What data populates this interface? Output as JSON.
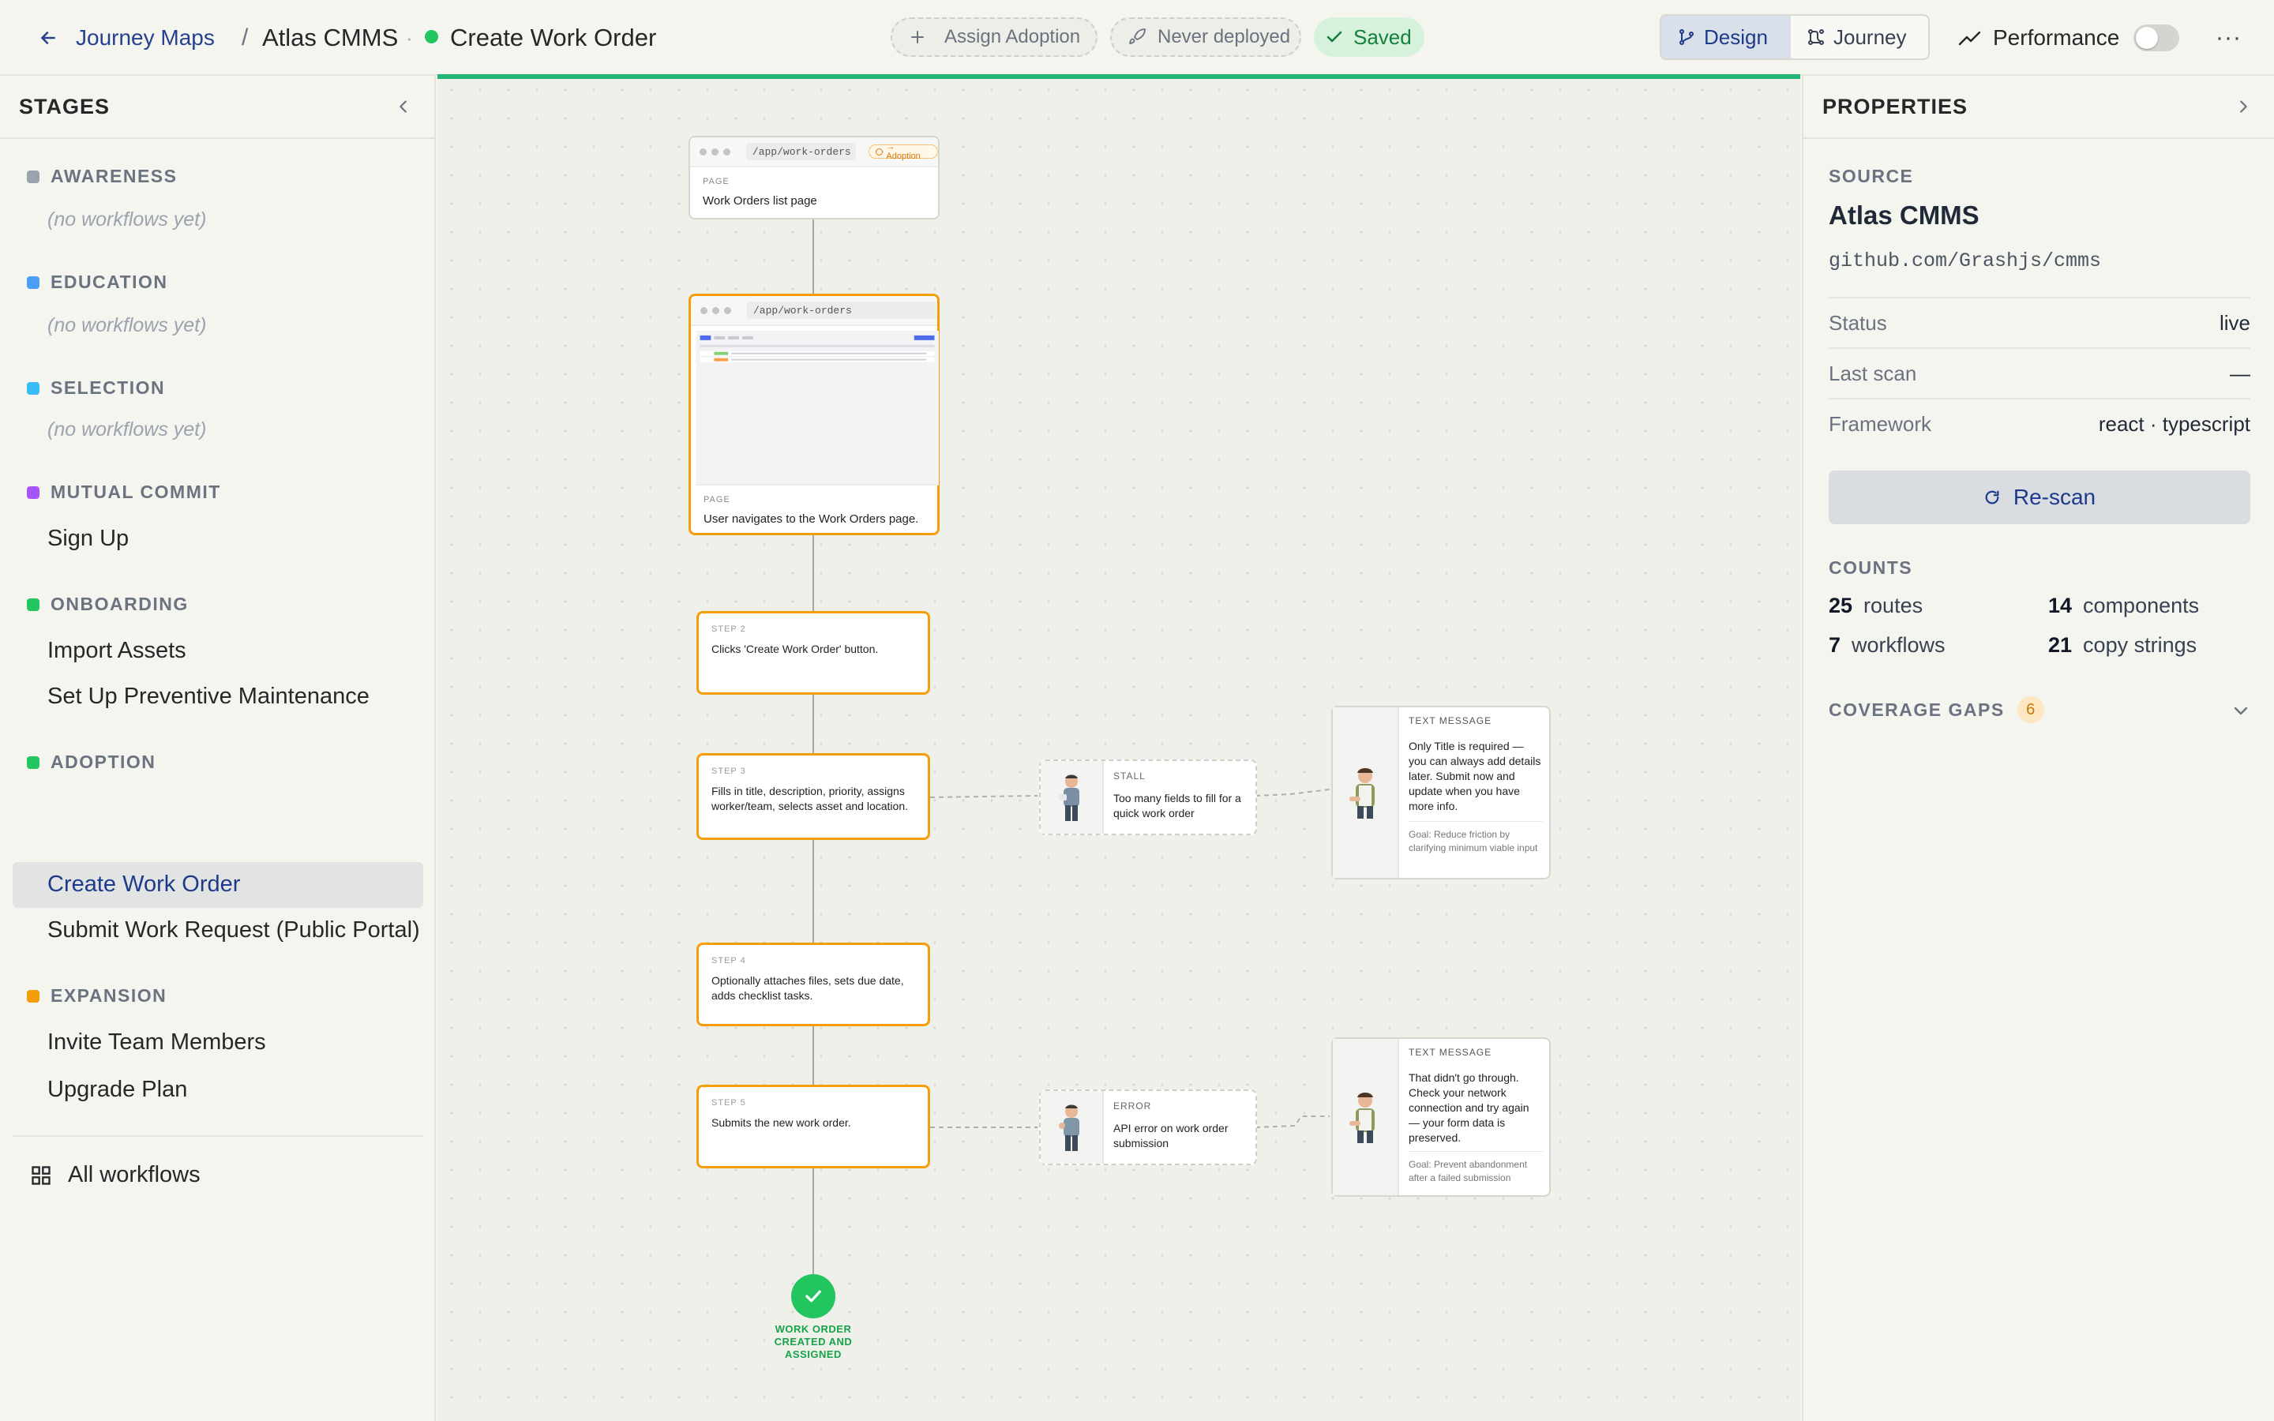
{
  "header": {
    "back_label": "Journey Maps",
    "breadcrumb_sep": "/",
    "app_name": "Atlas CMMS",
    "dot_sep": "·",
    "page_title": "Create Work Order",
    "status_color": "#22c55e",
    "assign_label": "Assign Adoption",
    "deploy_label": "Never deployed",
    "saved_label": "Saved",
    "view_tabs": [
      {
        "label": "Design",
        "icon": "branch-icon",
        "active": true
      },
      {
        "label": "Journey",
        "icon": "journey-icon",
        "active": false
      }
    ],
    "performance_label": "Performance",
    "performance_enabled": false,
    "more_label": "···"
  },
  "sidebar": {
    "title": "STAGES",
    "stages": [
      {
        "name": "AWARENESS",
        "color": "#9aa3ad",
        "empty": "(no workflows yet)",
        "workflows": []
      },
      {
        "name": "EDUCATION",
        "color": "#4a9ff5",
        "empty": "(no workflows yet)",
        "workflows": []
      },
      {
        "name": "SELECTION",
        "color": "#38bdf8",
        "empty": "(no workflows yet)",
        "workflows": []
      },
      {
        "name": "MUTUAL COMMIT",
        "color": "#a855f7",
        "workflows": [
          "Sign Up"
        ]
      },
      {
        "name": "ONBOARDING",
        "color": "#22c55e",
        "workflows": [
          "Import Assets",
          "Set Up Preventive Maintenance"
        ]
      },
      {
        "name": "ADOPTION",
        "color": "#22c55e",
        "workflows": [
          "Create Work Order",
          "Submit Work Request (Public Portal)"
        ]
      },
      {
        "name": "EXPANSION",
        "color": "#f59e0b",
        "workflows": [
          "Invite Team Members",
          "Upgrade Plan"
        ]
      }
    ],
    "active_workflow": "Create Work Order",
    "all_workflows_label": "All workflows"
  },
  "canvas": {
    "page_nodes": [
      {
        "url": "/app/work-orders",
        "badge": "→ Adoption",
        "label": "PAGE",
        "text": "Work Orders list page"
      },
      {
        "url": "/app/work-orders",
        "label": "PAGE",
        "text": "User navigates to the Work Orders page."
      }
    ],
    "steps": [
      {
        "label": "STEP 2",
        "text": "Clicks 'Create Work Order' button."
      },
      {
        "label": "STEP 3",
        "text": "Fills in title, description, priority, assigns worker/team, selects asset and location."
      },
      {
        "label": "STEP 4",
        "text": "Optionally attaches files, sets due date, adds checklist tasks."
      },
      {
        "label": "STEP 5",
        "text": "Submits the new work order."
      }
    ],
    "events": [
      {
        "label": "STALL",
        "text": "Too many fields to fill for a quick work order"
      },
      {
        "label": "ERROR",
        "text": "API error on work order submission"
      }
    ],
    "messages": [
      {
        "label": "TEXT MESSAGE",
        "text": "Only Title is required — you can always add details later. Submit now and update when you have more info.",
        "goal": "Goal: Reduce friction by clarifying minimum viable input"
      },
      {
        "label": "TEXT MESSAGE",
        "text": "That didn't go through. Check your network connection and try again — your form data is preserved.",
        "goal": "Goal: Prevent abandonment after a failed submission"
      }
    ],
    "end_label": "WORK ORDER CREATED AND ASSIGNED"
  },
  "properties": {
    "title": "PROPERTIES",
    "source_heading": "SOURCE",
    "source_name": "Atlas CMMS",
    "source_url": "github.com/Grashjs/cmms",
    "rows": [
      {
        "key": "Status",
        "value": "live"
      },
      {
        "key": "Last scan",
        "value": "—"
      },
      {
        "key": "Framework",
        "value": "react · typescript"
      }
    ],
    "rescan_label": "Re-scan",
    "counts_heading": "COUNTS",
    "counts": [
      {
        "value": "25",
        "label": "routes"
      },
      {
        "value": "14",
        "label": "components"
      },
      {
        "value": "7",
        "label": "workflows"
      },
      {
        "value": "21",
        "label": "copy strings"
      }
    ],
    "coverage_label": "COVERAGE GAPS",
    "coverage_count": "6"
  }
}
